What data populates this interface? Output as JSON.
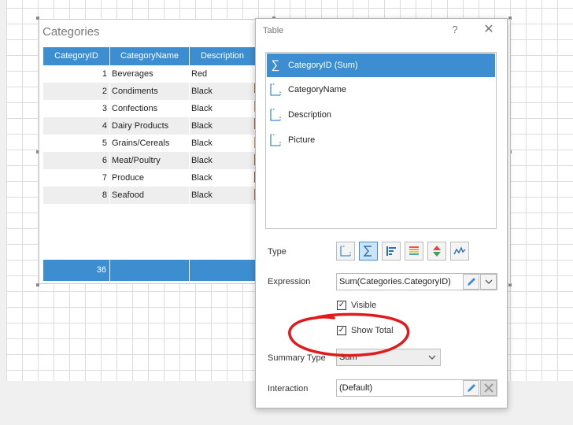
{
  "table": {
    "title": "Categories",
    "columns": [
      "CategoryID",
      "CategoryName",
      "Description"
    ],
    "rows": [
      {
        "id": "1",
        "name": "Beverages",
        "desc": "Red"
      },
      {
        "id": "2",
        "name": "Condiments",
        "desc": "Black"
      },
      {
        "id": "3",
        "name": "Confections",
        "desc": "Black"
      },
      {
        "id": "4",
        "name": "Dairy Products",
        "desc": "Black"
      },
      {
        "id": "5",
        "name": "Grains/Cereals",
        "desc": "Black"
      },
      {
        "id": "6",
        "name": "Meat/Poultry",
        "desc": "Black"
      },
      {
        "id": "7",
        "name": "Produce",
        "desc": "Black"
      },
      {
        "id": "8",
        "name": "Seafood",
        "desc": "Black"
      }
    ],
    "footer_total": "36"
  },
  "dialog": {
    "title": "Table",
    "help": "?",
    "close": "✕",
    "columns": [
      {
        "label": "CategoryID (Sum)",
        "icon": "sigma-icon",
        "selected": true
      },
      {
        "label": "CategoryName",
        "icon": "column-icon",
        "selected": false
      },
      {
        "label": "Description",
        "icon": "column-icon",
        "selected": false
      },
      {
        "label": "Picture",
        "icon": "column-icon",
        "selected": false
      }
    ],
    "type_label": "Type",
    "expression_label": "Expression",
    "expression_value": "Sum(Categories.CategoryID)",
    "visible_label": "Visible",
    "show_total_label": "Show Total",
    "summary_type_label": "Summary Type",
    "summary_type_value": "Sum",
    "interaction_label": "Interaction",
    "interaction_value": "(Default)"
  },
  "colors": {
    "accent": "#3d8ed1",
    "annotation": "#e01b1b"
  }
}
